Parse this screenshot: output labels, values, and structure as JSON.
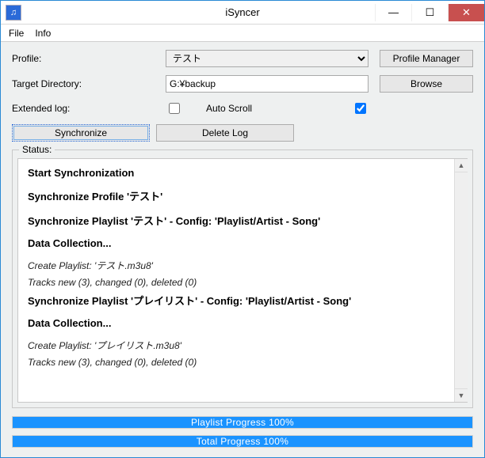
{
  "window": {
    "title": "iSyncer"
  },
  "menu": {
    "file": "File",
    "info": "Info"
  },
  "form": {
    "profile_label": "Profile:",
    "profile_value": "テスト",
    "profile_manager_btn": "Profile Manager",
    "target_label": "Target Directory:",
    "target_value": "G:¥backup",
    "browse_btn": "Browse",
    "extended_log_label": "Extended log:",
    "auto_scroll_label": "Auto Scroll",
    "extended_log_checked": false,
    "auto_scroll_checked": true
  },
  "actions": {
    "sync_btn": "Synchronize",
    "delete_log_btn": "Delete Log"
  },
  "status": {
    "group_label": "Status:",
    "lines": [
      {
        "type": "h",
        "text": "Start Synchronization"
      },
      {
        "type": "h",
        "text": "Synchronize Profile 'テスト'"
      },
      {
        "type": "h",
        "text": "Synchronize Playlist 'テスト' - Config: 'Playlist/Artist - Song'"
      },
      {
        "type": "h",
        "text": "Data Collection..."
      },
      {
        "type": "p",
        "text": "Create Playlist: 'テスト.m3u8'"
      },
      {
        "type": "p",
        "text": "Tracks new (3), changed (0), deleted (0)"
      },
      {
        "type": "h",
        "text": "Synchronize Playlist 'プレイリスト' - Config: 'Playlist/Artist - Song'"
      },
      {
        "type": "h",
        "text": "Data Collection..."
      },
      {
        "type": "p",
        "text": "Create Playlist: 'プレイリスト.m3u8'"
      },
      {
        "type": "p",
        "text": "Tracks new (3), changed (0), deleted (0)"
      }
    ]
  },
  "progress": {
    "playlist_label": "Playlist Progress 100%",
    "playlist_percent": 100,
    "total_label": "Total Progress 100%",
    "total_percent": 100
  },
  "icons": {
    "app_icon_glyph": "♫",
    "minimize_glyph": "—",
    "maximize_glyph": "☐",
    "close_glyph": "✕",
    "scroll_up": "▲",
    "scroll_down": "▼"
  }
}
